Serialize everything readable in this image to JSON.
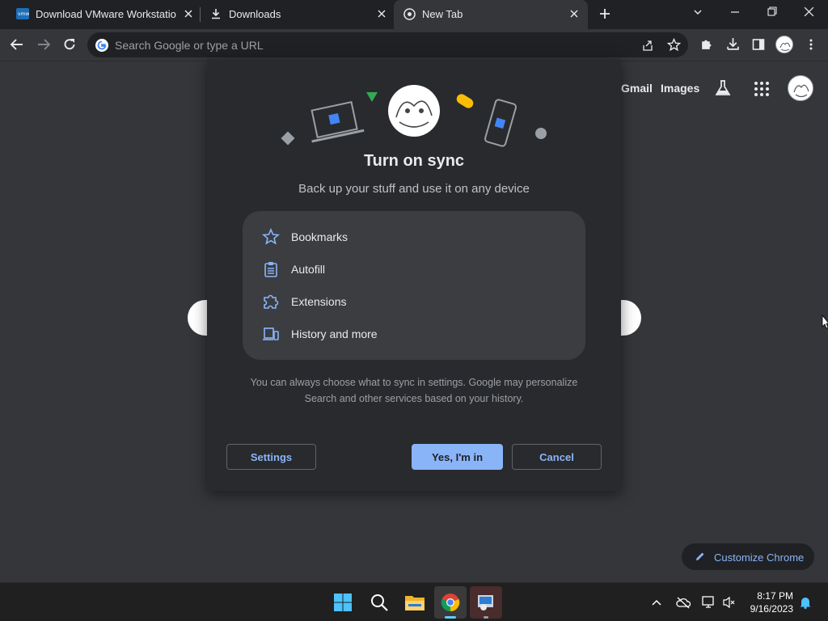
{
  "tabs": [
    {
      "title": "Download VMware Workstation P",
      "favicon": "vmware-icon"
    },
    {
      "title": "Downloads",
      "favicon": "download-icon"
    },
    {
      "title": "New Tab",
      "favicon": "chrome-icon"
    }
  ],
  "toolbar": {
    "omnibox_placeholder": "Search Google or type a URL"
  },
  "ntp": {
    "gmail": "Gmail",
    "images": "Images",
    "customize": "Customize Chrome"
  },
  "dialog": {
    "title": "Turn on sync",
    "subtitle": "Back up your stuff and use it on any device",
    "features": [
      {
        "label": "Bookmarks",
        "icon": "star-icon"
      },
      {
        "label": "Autofill",
        "icon": "clipboard-icon"
      },
      {
        "label": "Extensions",
        "icon": "puzzle-icon"
      },
      {
        "label": "History and more",
        "icon": "devices-icon"
      }
    ],
    "note": "You can always choose what to sync in settings. Google may personalize Search and other services based on your history.",
    "settings_label": "Settings",
    "yes_label": "Yes, I'm in",
    "cancel_label": "Cancel"
  },
  "taskbar": {
    "time": "8:17 PM",
    "date": "9/16/2023"
  },
  "colors": {
    "accent": "#8ab4f8",
    "background": "#35363a",
    "dialog": "#292a2d"
  }
}
